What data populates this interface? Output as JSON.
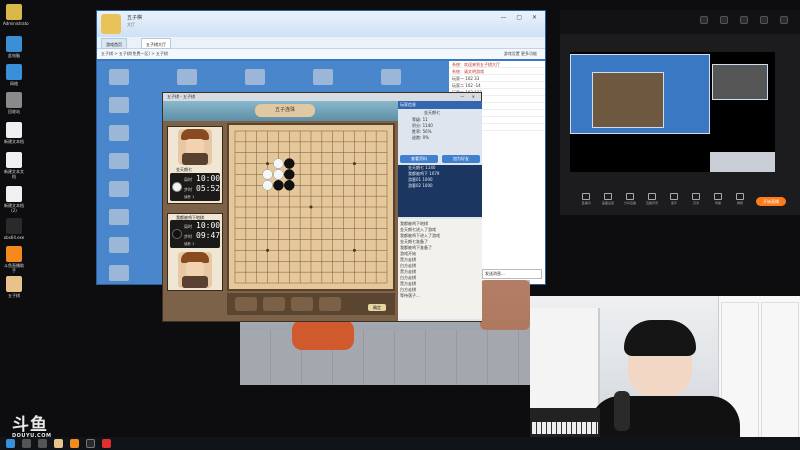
{
  "desktop_icons": [
    {
      "label": "Administrato",
      "color": "#d9b84a"
    },
    {
      "label": "此电脑",
      "color": "#3a8fd9"
    },
    {
      "label": "网络",
      "color": "#3a8fd9"
    },
    {
      "label": "回收站",
      "color": "#8a8a8a"
    },
    {
      "label": "新建文本档",
      "color": "#f0f0f0"
    },
    {
      "label": "新建文本文档",
      "color": "#f0f0f0"
    },
    {
      "label": "新建文本档(2)",
      "color": "#f0f0f0"
    },
    {
      "label": "obs64.exe",
      "color": "#2a2a2a"
    },
    {
      "label": "斗鱼直播助手",
      "color": "#f28a1e"
    },
    {
      "label": "五子棋",
      "color": "#e8c28a"
    }
  ],
  "lobby": {
    "app_name": "五子棋",
    "app_sub": "大厅",
    "tab1": "游戏首页",
    "tab2": "五子棋大厅",
    "crumb": "五子棋 > 五子棋(免费一区) > 五子棋",
    "crumb_right": "游戏设置   更多功能",
    "user_list": [
      {
        "name": "玩家一",
        "a": "102",
        "b": "33",
        "red": false
      },
      {
        "name": "玩家二",
        "a": "102",
        "b": "-14",
        "red": false
      },
      {
        "name": "玩家三",
        "a": "102",
        "b": "127",
        "red": false
      },
      {
        "name": "玩家四",
        "a": "102",
        "b": "-73",
        "red": false
      },
      {
        "name": "玩家五",
        "a": "102",
        "b": "51",
        "red": false
      },
      {
        "name": "玩家六",
        "a": "102",
        "b": "92",
        "red": false
      },
      {
        "name": "玩家七",
        "a": "102",
        "b": "14",
        "red": false
      },
      {
        "name": "玩家八",
        "a": "102",
        "b": "-20",
        "red": false
      }
    ],
    "chat_rows": [
      {
        "text": "系统：欢迎来到五子棋大厅",
        "red": true
      },
      {
        "text": "系统：请文明游戏",
        "red": true
      }
    ],
    "chat_input_placeholder": "发送消息..."
  },
  "game": {
    "window_title": "五子棋 - 五子棋",
    "banner_title": "五子连珠",
    "player_top": {
      "name": "金天朗七",
      "clock_label": "局时",
      "clock_value": "10:00",
      "move_label": "步时",
      "move_value": "05:52",
      "extra": "读秒 1"
    },
    "player_bottom": {
      "name": "我都被鸡下地棋",
      "clock_label": "局时",
      "clock_value": "10:00",
      "move_label": "步时",
      "move_value": "09:47",
      "extra": "读秒 1"
    },
    "confirm_label": "确定",
    "side": {
      "title": "玩家信息",
      "user": "金天朗七",
      "stats": [
        "等级: 11",
        "积分: 1140",
        "胜率: 56%",
        "逃跑: 0%"
      ],
      "btn1": "查看资料",
      "btn2": "加为好友",
      "list": [
        {
          "name": "金天朗七",
          "score": "1140"
        },
        {
          "name": "我都被鸡下",
          "score": "1079"
        },
        {
          "name": "游客01",
          "score": "1000"
        },
        {
          "name": "游客02",
          "score": "1000"
        }
      ],
      "log": [
        "我都被鸡下地棋",
        "金天朗七进入了游戏",
        "我都被鸡下进入了游戏",
        "金天朗七准备了",
        "我都被鸡下准备了",
        "游戏开始",
        "黑方走棋",
        "白方走棋",
        "黑方走棋",
        "白方走棋",
        "黑方走棋",
        "白方走棋",
        "等待落子..."
      ]
    },
    "stones": [
      {
        "c": "white",
        "x": 4,
        "y": 3
      },
      {
        "c": "black",
        "x": 5,
        "y": 3
      },
      {
        "c": "white",
        "x": 3,
        "y": 4
      },
      {
        "c": "white",
        "x": 4,
        "y": 4
      },
      {
        "c": "black",
        "x": 5,
        "y": 4
      },
      {
        "c": "black",
        "x": 4,
        "y": 5
      },
      {
        "c": "black",
        "x": 5,
        "y": 5
      },
      {
        "c": "white",
        "x": 3,
        "y": 5
      }
    ]
  },
  "stream_panel": {
    "tools": [
      "直播间",
      "画面设置",
      "分享直播",
      "直播背景",
      "变声",
      "高清",
      "导播",
      "弹幕"
    ],
    "live_button": "开始直播"
  },
  "watermark": {
    "main": "斗鱼",
    "sub": "DOUYU.COM"
  }
}
